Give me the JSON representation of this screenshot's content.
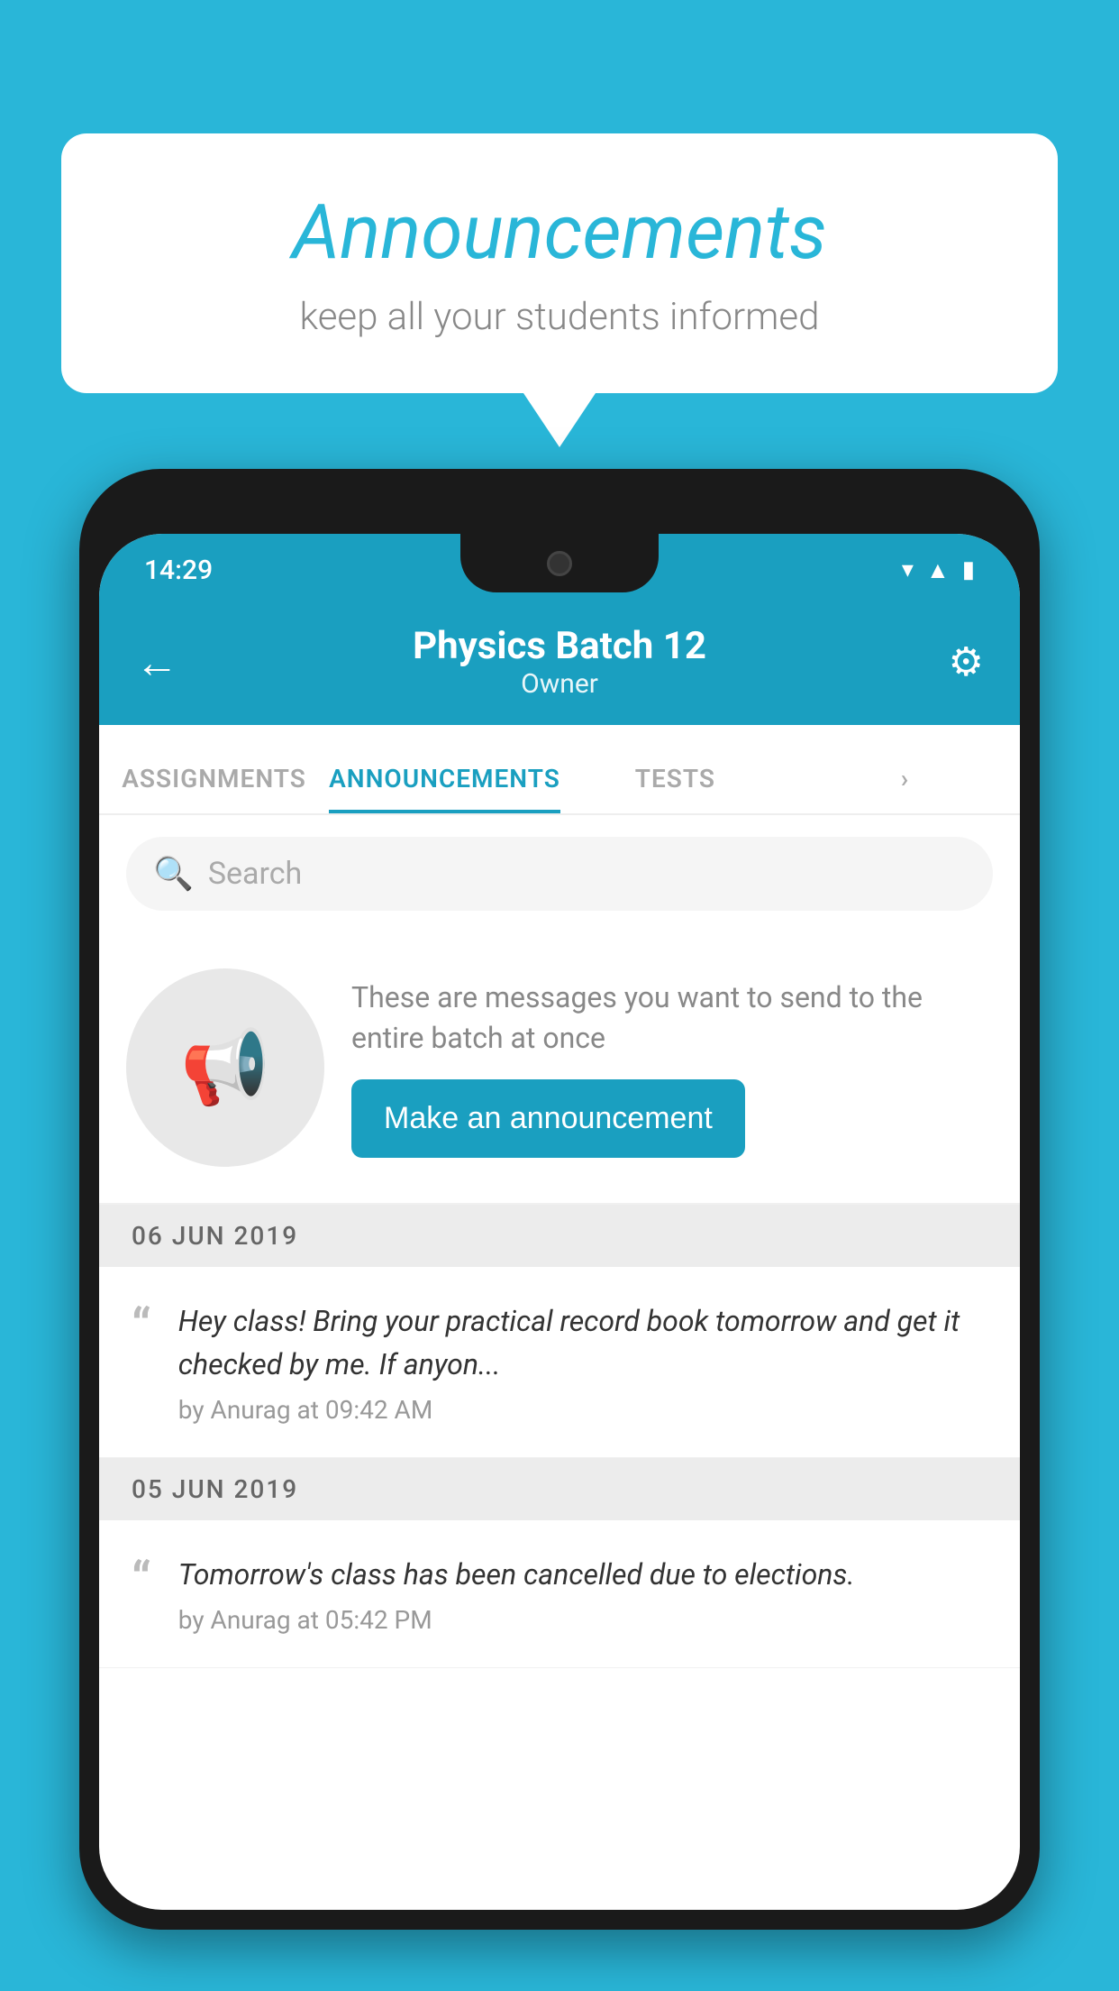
{
  "background_color": "#29b6d8",
  "speech_bubble": {
    "title": "Announcements",
    "subtitle": "keep all your students informed"
  },
  "phone": {
    "status_bar": {
      "time": "14:29",
      "icons": [
        "wifi",
        "signal",
        "battery"
      ]
    },
    "app_bar": {
      "title": "Physics Batch 12",
      "subtitle": "Owner",
      "back_label": "←",
      "gear_label": "⚙"
    },
    "tabs": [
      {
        "label": "ASSIGNMENTS",
        "active": false
      },
      {
        "label": "ANNOUNCEMENTS",
        "active": true
      },
      {
        "label": "TESTS",
        "active": false
      },
      {
        "label": "",
        "active": false
      }
    ],
    "search": {
      "placeholder": "Search"
    },
    "promo": {
      "description": "These are messages you want to send to the entire batch at once",
      "button_label": "Make an announcement"
    },
    "announcements": [
      {
        "date": "06  JUN  2019",
        "text": "Hey class! Bring your practical record book tomorrow and get it checked by me. If anyon...",
        "meta": "by Anurag at 09:42 AM"
      },
      {
        "date": "05  JUN  2019",
        "text": "Tomorrow's class has been cancelled due to elections.",
        "meta": "by Anurag at 05:42 PM"
      }
    ]
  }
}
